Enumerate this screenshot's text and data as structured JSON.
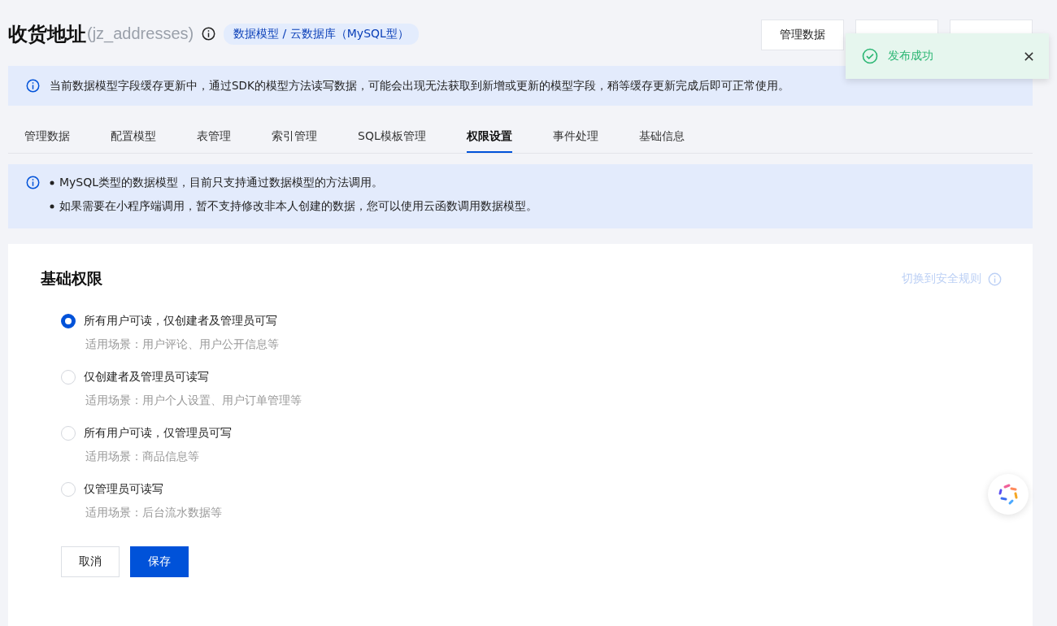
{
  "header": {
    "title": "收货地址",
    "subtitle": "(jz_addresses)",
    "tag": "数据模型 / 云数据库（MySQL型）",
    "buttons": [
      {
        "kind": "text",
        "label": "管理数据"
      },
      {
        "kind": "covered"
      },
      {
        "kind": "covered"
      }
    ]
  },
  "toast": {
    "message": "发布成功"
  },
  "cache_notice": "当前数据模型字段缓存更新中，通过SDK的模型方法读写数据，可能会出现无法获取到新增或更新的模型字段，稍等缓存更新完成后即可正常使用。",
  "tabs": [
    {
      "label": "管理数据",
      "selected": false
    },
    {
      "label": "配置模型",
      "selected": false
    },
    {
      "label": "表管理",
      "selected": false
    },
    {
      "label": "索引管理",
      "selected": false
    },
    {
      "label": "SQL模板管理",
      "selected": false
    },
    {
      "label": "权限设置",
      "selected": true
    },
    {
      "label": "事件处理",
      "selected": false
    },
    {
      "label": "基础信息",
      "selected": false
    }
  ],
  "mysql_notice": [
    "MySQL类型的数据模型，目前只支持通过数据模型的方法调用。",
    "如果需要在小程序端调用，暂不支持修改非本人创建的数据，您可以使用云函数调用数据模型。"
  ],
  "permissions": {
    "title": "基础权限",
    "switch_link": "切换到安全规则",
    "options": [
      {
        "label": "所有用户可读，仅创建者及管理员可写",
        "hint": "适用场景：用户评论、用户公开信息等",
        "selected": true
      },
      {
        "label": "仅创建者及管理员可读写",
        "hint": "适用场景：用户个人设置、用户订单管理等",
        "selected": false
      },
      {
        "label": "所有用户可读，仅管理员可写",
        "hint": "适用场景：商品信息等",
        "selected": false
      },
      {
        "label": "仅管理员可读写",
        "hint": "适用场景：后台流水数据等",
        "selected": false
      }
    ],
    "cancel": "取消",
    "save": "保存"
  }
}
